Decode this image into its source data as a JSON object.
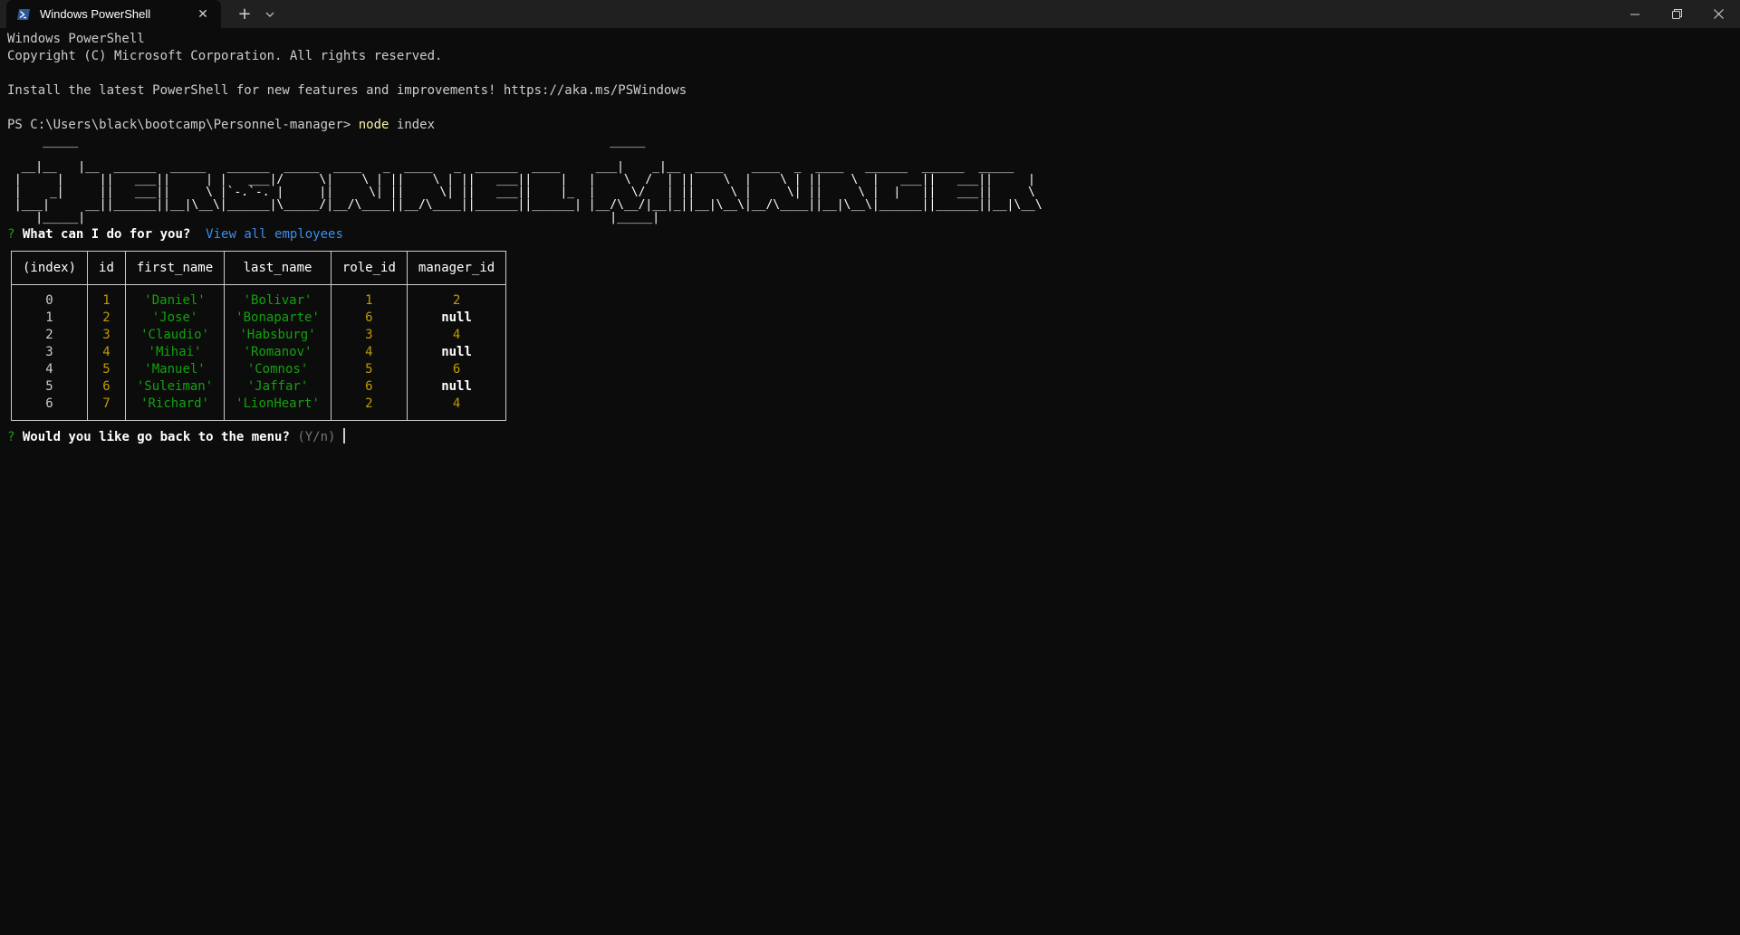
{
  "window": {
    "tab_title": "Windows PowerShell",
    "tab_icon": "powershell-icon",
    "new_tab_icon": "plus-icon",
    "dropdown_icon": "chevron-down-icon",
    "close_tab_icon": "close-icon",
    "controls": [
      "minimize-icon",
      "maximize-icon",
      "close-icon"
    ]
  },
  "terminal": {
    "header_line1": "Windows PowerShell",
    "header_line2": "Copyright (C) Microsoft Corporation. All rights reserved.",
    "install_line": "Install the latest PowerShell for new features and improvements! https://aka.ms/PSWindows",
    "prompt_path": "PS C:\\Users\\black\\bootcamp\\Personnel-manager>",
    "prompt_cmd": "node",
    "prompt_arg": "index",
    "ascii_art": [
      "     _____                                                                           _____",
      "",
      "  __|__   |__  ______  _____   ______  _____  ____   _  ____   _  ______  ____     ___|    _|__  ____    ____  _  ____   ______  ______  _____",
      " |     |     ||   ___||     | |   ___|/     \\|    \\ | ||    \\ | ||   ___||    |   |    \\  /  | ||    \\  |    \\ | ||    \\  |   ___||   ___||     |",
      " |    _|     ||   ___||     \\ |`-.`-. |     ||     \\| ||     \\| ||   ___||    |_  |     \\/   | ||     \\ |     \\| ||     \\ |  |   ||   ___||     \\",
      " |___|     __||______||__|\\__\\|______|\\_____/|__/\\____||__/\\____||______||______| |__/\\__/|__|_||__|\\__\\|__/\\____||__|\\__\\|______||______||__|\\__\\",
      "    |_____|                                                                          |_____|"
    ],
    "question1_mark": "?",
    "question1_text": "What can I do for you?",
    "question1_answer": "View all employees",
    "question2_mark": "?",
    "question2_text": "Would you like go back to the menu?",
    "question2_hint": "(Y/n)"
  },
  "table": {
    "columns": [
      "(index)",
      "id",
      "first_name",
      "last_name",
      "role_id",
      "manager_id"
    ],
    "rows": [
      {
        "index": "0",
        "id": "1",
        "first_name": "'Daniel'",
        "last_name": "'Bolivar'",
        "role_id": "1",
        "manager_id": "2"
      },
      {
        "index": "1",
        "id": "2",
        "first_name": "'Jose'",
        "last_name": "'Bonaparte'",
        "role_id": "6",
        "manager_id": "null"
      },
      {
        "index": "2",
        "id": "3",
        "first_name": "'Claudio'",
        "last_name": "'Habsburg'",
        "role_id": "3",
        "manager_id": "4"
      },
      {
        "index": "3",
        "id": "4",
        "first_name": "'Mihai'",
        "last_name": "'Romanov'",
        "role_id": "4",
        "manager_id": "null"
      },
      {
        "index": "4",
        "id": "5",
        "first_name": "'Manuel'",
        "last_name": "'Comnos'",
        "role_id": "5",
        "manager_id": "6"
      },
      {
        "index": "5",
        "id": "6",
        "first_name": "'Suleiman'",
        "last_name": "'Jaffar'",
        "role_id": "6",
        "manager_id": "null"
      },
      {
        "index": "6",
        "id": "7",
        "first_name": "'Richard'",
        "last_name": "'LionHeart'",
        "role_id": "2",
        "manager_id": "4"
      }
    ]
  }
}
